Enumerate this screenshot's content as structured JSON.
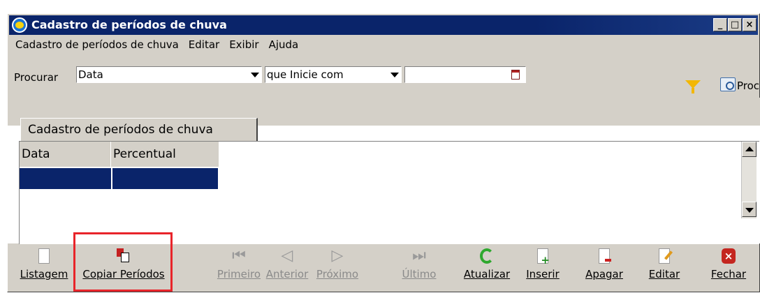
{
  "window": {
    "title": "Cadastro de períodos de chuva",
    "controls": {
      "minimize": "_",
      "maximize": "□",
      "close": "×"
    }
  },
  "menu": {
    "items": [
      "Cadastro de períodos de chuva",
      "Editar",
      "Exibir",
      "Ajuda"
    ]
  },
  "search": {
    "label": "Procurar",
    "field_value": "Data",
    "condition_value": "que Inicie com",
    "term_value": "",
    "button_label": "Procurar"
  },
  "tab": {
    "label": "Cadastro de períodos de chuva"
  },
  "grid": {
    "columns": [
      "Data",
      "Percentual"
    ]
  },
  "toolbar": {
    "items": [
      {
        "label": "Listagem",
        "icon": "document-icon",
        "enabled": true
      },
      {
        "label": "Copiar Períodos",
        "icon": "copy-icon",
        "enabled": true
      },
      {
        "label": "Primeiro",
        "icon": "first-icon",
        "enabled": false
      },
      {
        "label": "Anterior",
        "icon": "previous-icon",
        "enabled": false
      },
      {
        "label": "Próximo",
        "icon": "next-icon",
        "enabled": false
      },
      {
        "label": "Último",
        "icon": "last-icon",
        "enabled": false
      },
      {
        "label": "Atualizar",
        "icon": "refresh-icon",
        "enabled": true
      },
      {
        "label": "Inserir",
        "icon": "insert-icon",
        "enabled": true
      },
      {
        "label": "Apagar",
        "icon": "delete-icon",
        "enabled": true
      },
      {
        "label": "Editar",
        "icon": "edit-icon",
        "enabled": true
      },
      {
        "label": "Fechar",
        "icon": "close-icon",
        "enabled": true
      }
    ]
  },
  "colors": {
    "titlebar": "#0a246a",
    "selection": "#0a246a",
    "window_bg": "#d4d0c8",
    "highlight": "#e8242a"
  }
}
